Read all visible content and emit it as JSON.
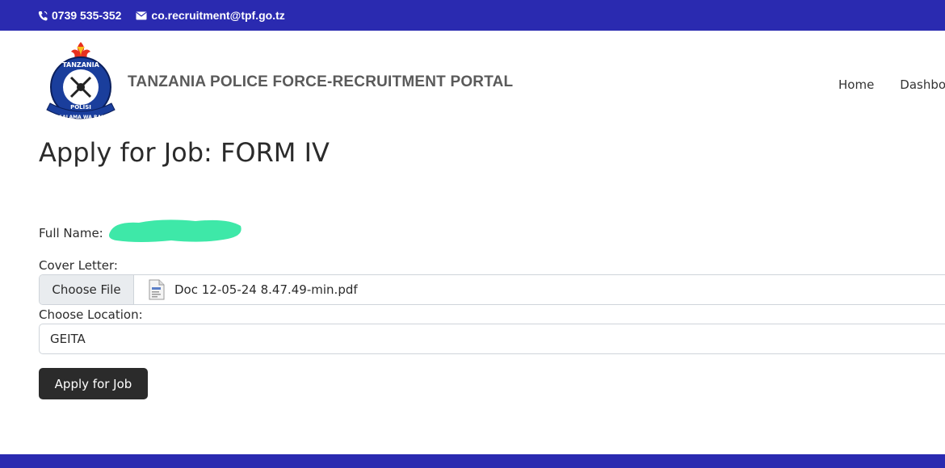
{
  "topbar": {
    "phone": "0739 535-352",
    "email": "co.recruitment@tpf.go.tz",
    "phone_icon": "phone-icon",
    "email_icon": "envelope-icon",
    "background": "#2a2ab0"
  },
  "header": {
    "logo_text_top": "TANZANIA",
    "logo_text_center": "POLISI",
    "logo_text_bottom": "USALAMA WA RAIA",
    "title": "TANZANIA POLICE FORCE-RECRUITMENT PORTAL",
    "nav": [
      "Home",
      "Dashbo"
    ]
  },
  "page": {
    "title": "Apply for Job: FORM IV"
  },
  "form": {
    "full_name_label": "Full Name:",
    "cover_letter_label": "Cover Letter:",
    "choose_file_label": "Choose File",
    "file_name": "Doc 12-05-24 8.47.49-min.pdf",
    "file_icon": "pdf-file-icon",
    "location_label": "Choose Location:",
    "location_value": "GEITA",
    "submit_label": "Apply for Job"
  },
  "colors": {
    "brand_blue": "#2a2ab0",
    "button_dark": "#2b2b2b",
    "redaction": "#3ee8a8"
  }
}
